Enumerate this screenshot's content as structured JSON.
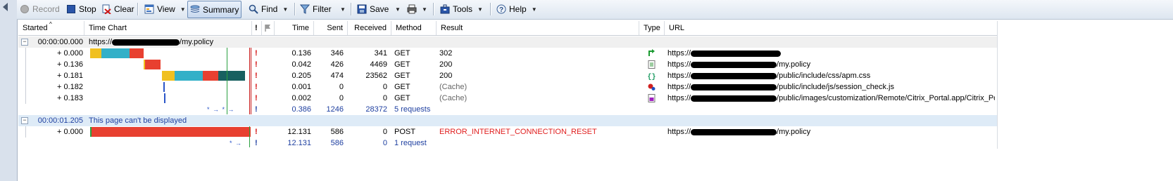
{
  "toolbar": {
    "record": "Record",
    "stop": "Stop",
    "clear": "Clear",
    "view": "View",
    "summary": "Summary",
    "find": "Find",
    "filter": "Filter",
    "save": "Save",
    "tools": "Tools",
    "help": "Help"
  },
  "columns": {
    "started": "Started",
    "timechart": "Time Chart",
    "bang": "!",
    "time": "Time",
    "sent": "Sent",
    "received": "Received",
    "method": "Method",
    "result": "Result",
    "type": "Type",
    "url": "URL"
  },
  "groups": [
    {
      "started": "00:00:00.000",
      "title_prefix": "https://",
      "title_suffix": "/my.policy",
      "entries": [
        {
          "started": "+ 0.000",
          "time": "0.136",
          "sent": "346",
          "received": "341",
          "method": "GET",
          "result": "302",
          "type_icon": "redirect-icon",
          "url_prefix": "https://",
          "url_suffix": ""
        },
        {
          "started": "+ 0.136",
          "time": "0.042",
          "sent": "426",
          "received": "4469",
          "method": "GET",
          "result": "200",
          "type_icon": "document-icon",
          "url_prefix": "https://",
          "url_suffix": "/my.policy"
        },
        {
          "started": "+ 0.181",
          "time": "0.205",
          "sent": "474",
          "received": "23562",
          "method": "GET",
          "result": "200",
          "type_icon": "css-icon",
          "url_prefix": "https://",
          "url_suffix": "/public/include/css/apm.css"
        },
        {
          "started": "+ 0.182",
          "time": "0.001",
          "sent": "0",
          "received": "0",
          "method": "GET",
          "result": "(Cache)",
          "type_icon": "script-icon",
          "url_prefix": "https://",
          "url_suffix": "/public/include/js/session_check.js"
        },
        {
          "started": "+ 0.183",
          "time": "0.002",
          "sent": "0",
          "received": "0",
          "method": "GET",
          "result": "(Cache)",
          "type_icon": "image-icon",
          "url_prefix": "https://",
          "url_suffix": "/public/images/customization/Remote/Citrix_Portal.app/Citrix_Po..."
        }
      ],
      "summary": {
        "time": "0.386",
        "sent": "1246",
        "received": "28372",
        "label": "5 requests"
      }
    },
    {
      "started": "00:00:01.205",
      "title": "This page can't be displayed",
      "entries": [
        {
          "started": "+ 0.000",
          "time": "12.131",
          "sent": "586",
          "received": "0",
          "method": "POST",
          "result": "ERROR_INTERNET_CONNECTION_RESET",
          "type_icon": "",
          "url_prefix": "https://",
          "url_suffix": "/my.policy"
        }
      ],
      "summary": {
        "time": "12.131",
        "sent": "586",
        "received": "0",
        "label": "1 request"
      }
    }
  ],
  "colors": {
    "wait": "#f0c020",
    "connect": "#33b0c8",
    "send": "#e84030",
    "receive": "#186060",
    "error_text": "#e01e1e",
    "summary_text": "#1e3fa0"
  }
}
